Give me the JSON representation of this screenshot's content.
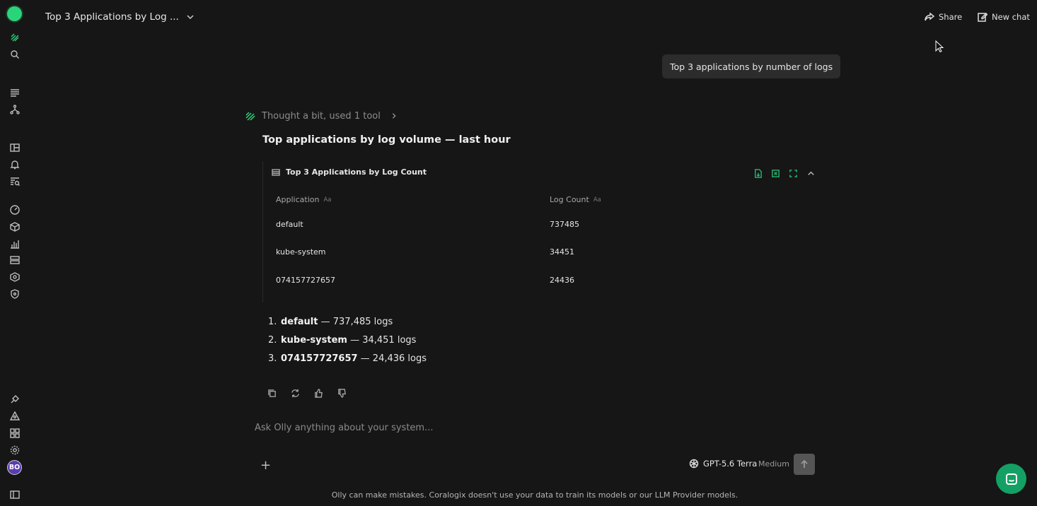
{
  "header": {
    "chat_title": "Top 3 Applications by Log ...",
    "share_label": "Share",
    "new_chat_label": "New chat"
  },
  "rail_icons": [
    "logo-mark",
    "search-icon",
    "logs-icon",
    "traces-icon",
    "dashboards-icon",
    "alerts-icon",
    "explore-icon",
    "apm-icon",
    "infrastructure-icon",
    "metrics-icon",
    "data-icon",
    "security-icon",
    "shield-icon",
    "integrations-icon",
    "alerts-bell-icon",
    "apps-grid-icon",
    "settings-icon"
  ],
  "avatar_initials": "BO",
  "user_message": "Top 3 applications by number of logs",
  "assistant": {
    "thought_label": "Thought a bit, used 1 tool",
    "answer_title": "Top applications by log volume — last hour",
    "table": {
      "title": "Top 3 Applications by Log Count",
      "columns": [
        "Application",
        "Log Count"
      ],
      "type_glyph": "Aa",
      "rows": [
        [
          "default",
          "737485"
        ],
        [
          "kube-system",
          "34451"
        ],
        [
          "074157727657",
          "24436"
        ]
      ]
    },
    "list": [
      {
        "num": "1.",
        "name": "default",
        "rest": " — 737,485 logs"
      },
      {
        "num": "2.",
        "name": "kube-system",
        "rest": " — 34,451 logs"
      },
      {
        "num": "3.",
        "name": "074157727657",
        "rest": " — 24,436 logs"
      }
    ]
  },
  "composer": {
    "placeholder": "Ask Olly anything about your system...",
    "model": "GPT-5.6 Terra",
    "effort": "Medium"
  },
  "disclaimer": "Olly can make mistakes. Coralogix doesn't use your data to train its models or our LLM Provider models.",
  "colors": {
    "background": "#161616",
    "accent": "#2ad579",
    "fab": "#14a064"
  }
}
